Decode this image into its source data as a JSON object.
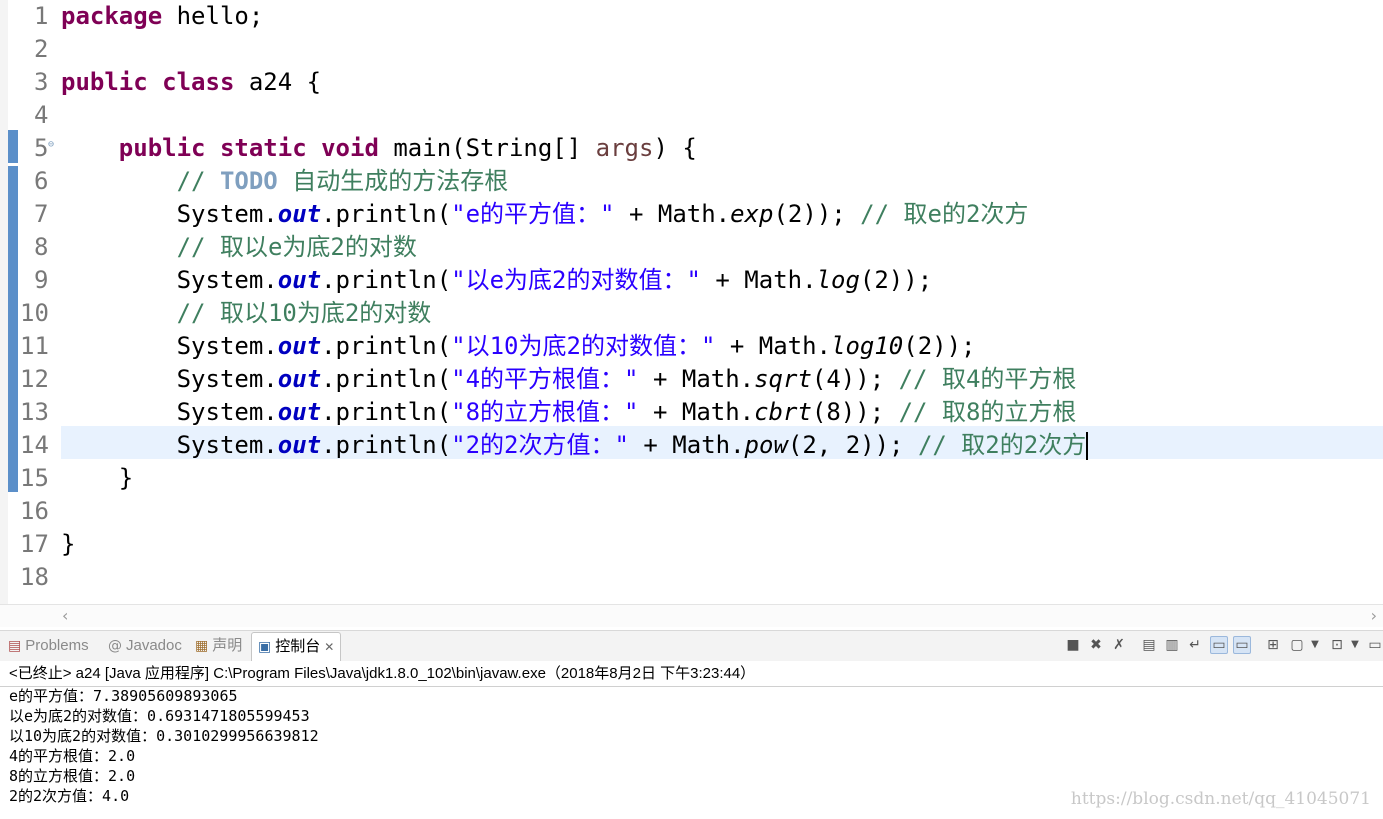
{
  "editor": {
    "line_numbers": [
      "1",
      "2",
      "3",
      "4",
      "5",
      "6",
      "7",
      "8",
      "9",
      "10",
      "11",
      "12",
      "13",
      "14",
      "15",
      "16",
      "17",
      "18"
    ],
    "lines": {
      "l1": {
        "kw": "package",
        "rest": " hello;"
      },
      "l3": {
        "kw1": "public",
        "kw2": "class",
        "rest": " a24 {"
      },
      "l5": {
        "kw1": "public",
        "kw2": "static",
        "kw3": "void",
        "a": " main(String[] ",
        "arg": "args",
        "b": ") {"
      },
      "l6": {
        "cm1": "// ",
        "todo": "TODO",
        "cm2": " 自动生成的方法存根"
      },
      "l7": {
        "a": "System.",
        "fld": "out",
        "b": ".println(",
        "str": "\"e的平方值：\"",
        "c": " + Math.",
        "m": "exp",
        "d": "(2)); ",
        "cm": "// 取e的2次方"
      },
      "l8": {
        "cm": "// 取以e为底2的对数"
      },
      "l9": {
        "a": "System.",
        "fld": "out",
        "b": ".println(",
        "str": "\"以e为底2的对数值：\"",
        "c": " + Math.",
        "m": "log",
        "d": "(2));"
      },
      "l10": {
        "cm": "// 取以10为底2的对数"
      },
      "l11": {
        "a": "System.",
        "fld": "out",
        "b": ".println(",
        "str": "\"以10为底2的对数值：\"",
        "c": " + Math.",
        "m": "log10",
        "d": "(2));"
      },
      "l12": {
        "a": "System.",
        "fld": "out",
        "b": ".println(",
        "str": "\"4的平方根值：\"",
        "c": " + Math.",
        "m": "sqrt",
        "d": "(4)); ",
        "cm": "// 取4的平方根"
      },
      "l13": {
        "a": "System.",
        "fld": "out",
        "b": ".println(",
        "str": "\"8的立方根值：\"",
        "c": " + Math.",
        "m": "cbrt",
        "d": "(8)); ",
        "cm": "// 取8的立方根"
      },
      "l14": {
        "a": "System.",
        "fld": "out",
        "b": ".println(",
        "str": "\"2的2次方值：\"",
        "c": " + Math.",
        "m": "pow",
        "d": "(2, 2)); ",
        "cm": "// 取2的2次方"
      },
      "l15": {
        "rest": "}"
      },
      "l17": {
        "rest": "}"
      }
    },
    "colors": {
      "keyword": "#7f0055",
      "string": "#2a00ff",
      "comment": "#3f7f5f",
      "field": "#0000c0",
      "current_line": "#e8f2fe"
    }
  },
  "tabs": [
    {
      "label": "Problems",
      "icon": "problems-icon"
    },
    {
      "label": "Javadoc",
      "icon": "javadoc-icon"
    },
    {
      "label": "声明",
      "icon": "declaration-icon"
    },
    {
      "label": "控制台",
      "icon": "console-icon",
      "active": true
    }
  ],
  "console": {
    "header": "<已终止> a24 [Java 应用程序] C:\\Program Files\\Java\\jdk1.8.0_102\\bin\\javaw.exe（2018年8月2日 下午3:23:44）",
    "output": [
      "e的平方值：7.38905609893065",
      "以e为底2的对数值：0.6931471805599453",
      "以10为底2的对数值：0.3010299956639812",
      "4的平方根值：2.0",
      "8的立方根值：2.0",
      "2的2次方值：4.0"
    ]
  },
  "watermark": "https://blog.csdn.net/qq_41045071"
}
